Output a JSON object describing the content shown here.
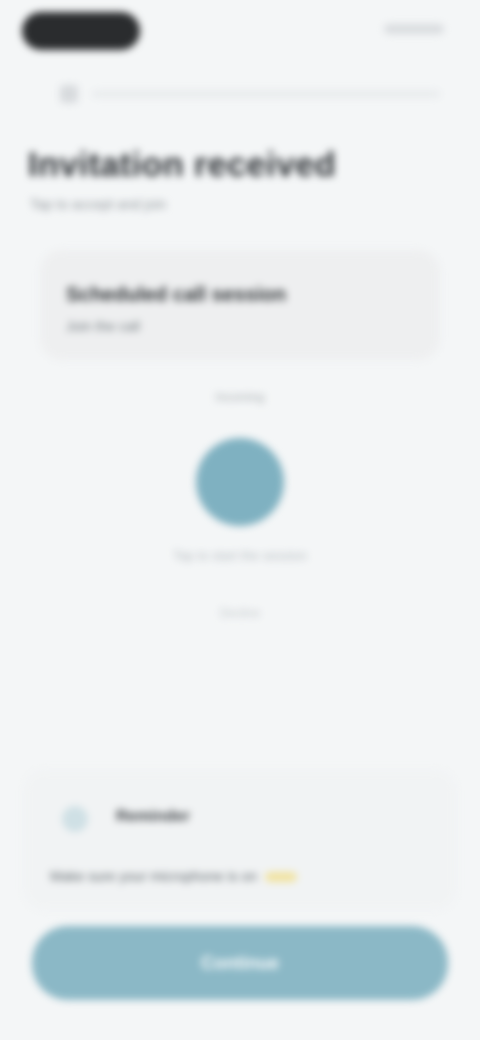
{
  "title": "Invitation received",
  "subtitle": "Tap to accept and join",
  "card": {
    "title": "Scheduled call session",
    "subtitle": "Join the call"
  },
  "hint": "Incoming",
  "circle_label": "Tap to start the session",
  "small_link": "Decline",
  "bottom_card": {
    "title": "Reminder",
    "text": "Make sure your microphone is on"
  },
  "cta_label": "Continue",
  "icons": {
    "back": "back-chevron-icon",
    "reminder": "info-icon"
  }
}
